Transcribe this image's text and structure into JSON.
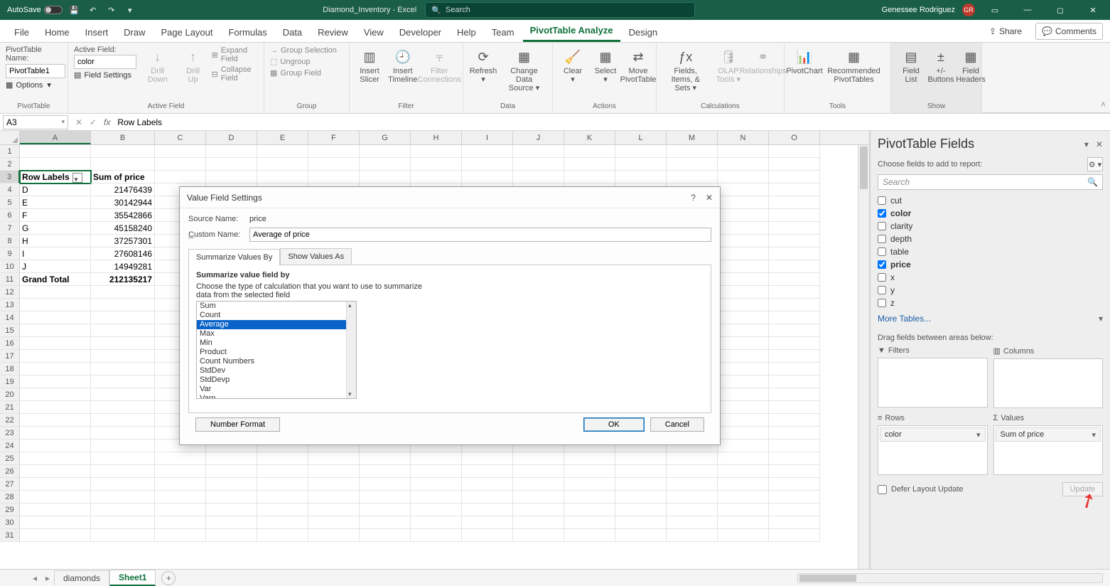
{
  "titlebar": {
    "autosave": "AutoSave",
    "autosave_state": "Off",
    "doc": "Diamond_Inventory  -  Excel",
    "search_placeholder": "Search",
    "user": "Genessee Rodriguez",
    "user_initials": "GR"
  },
  "tabs": [
    "File",
    "Home",
    "Insert",
    "Draw",
    "Page Layout",
    "Formulas",
    "Data",
    "Review",
    "View",
    "Developer",
    "Help",
    "Team",
    "PivotTable Analyze",
    "Design"
  ],
  "active_tab": "PivotTable Analyze",
  "ribbon_right": {
    "share": "Share",
    "comments": "Comments"
  },
  "ribbon": {
    "pt": {
      "name_label": "PivotTable Name:",
      "name_value": "PivotTable1",
      "options": "Options",
      "group_label": "PivotTable"
    },
    "af": {
      "name_label": "Active Field:",
      "name_value": "color",
      "settings": "Field Settings",
      "drill_down": "Drill\nDown",
      "drill_up": "Drill\nUp",
      "expand": "Expand Field",
      "collapse": "Collapse Field",
      "group_label": "Active Field"
    },
    "grp": {
      "sel": "Group Selection",
      "ungroup": "Ungroup",
      "field": "Group Field",
      "group_label": "Group"
    },
    "filter": {
      "slicer": "Insert\nSlicer",
      "timeline": "Insert\nTimeline",
      "conn": "Filter\nConnections",
      "group_label": "Filter"
    },
    "data": {
      "refresh": "Refresh",
      "change": "Change Data\nSource",
      "group_label": "Data"
    },
    "actions": {
      "clear": "Clear",
      "select": "Select",
      "move": "Move\nPivotTable",
      "group_label": "Actions"
    },
    "calc": {
      "fis": "Fields, Items,\n& Sets",
      "olap": "OLAP\nTools",
      "rel": "Relationships",
      "group_label": "Calculations"
    },
    "tools": {
      "chart": "PivotChart",
      "rec": "Recommended\nPivotTables",
      "group_label": "Tools"
    },
    "show": {
      "list": "Field\nList",
      "btns": "+/-\nButtons",
      "hdrs": "Field\nHeaders",
      "group_label": "Show"
    }
  },
  "namebox": "A3",
  "formula": "Row Labels",
  "columns": [
    "A",
    "B",
    "C",
    "D",
    "E",
    "F",
    "G",
    "H",
    "I",
    "J",
    "K",
    "L",
    "M",
    "N",
    "O"
  ],
  "pivot": {
    "header_row": "Row Labels",
    "header_val": "Sum of price",
    "rows": [
      {
        "label": "D",
        "val": "21476439"
      },
      {
        "label": "E",
        "val": "30142944"
      },
      {
        "label": "F",
        "val": "35542866"
      },
      {
        "label": "G",
        "val": "45158240"
      },
      {
        "label": "H",
        "val": "37257301"
      },
      {
        "label": "I",
        "val": "27608146"
      },
      {
        "label": "J",
        "val": "14949281"
      }
    ],
    "total_label": "Grand Total",
    "total_val": "212135217"
  },
  "dialog": {
    "title": "Value Field Settings",
    "source_label": "Source Name:",
    "source_value": "price",
    "custom_label": "Custom Name:",
    "custom_value": "Average of price",
    "tab1": "Summarize Values By",
    "tab2": "Show Values As",
    "section_hdr": "Summarize value field by",
    "desc1": "Choose the type of calculation that you want to use to summarize",
    "desc2": "data from the selected field",
    "options": [
      "Sum",
      "Count",
      "Average",
      "Max",
      "Min",
      "Product",
      "Count Numbers",
      "StdDev",
      "StdDevp",
      "Var",
      "Varp"
    ],
    "selected": "Average",
    "nfmt": "Number Format",
    "ok": "OK",
    "cancel": "Cancel"
  },
  "pane": {
    "title": "PivotTable Fields",
    "sub": "Choose fields to add to report:",
    "search": "Search",
    "fields": [
      {
        "name": "cut",
        "checked": false,
        "bold": false
      },
      {
        "name": "color",
        "checked": true,
        "bold": true
      },
      {
        "name": "clarity",
        "checked": false,
        "bold": false
      },
      {
        "name": "depth",
        "checked": false,
        "bold": false
      },
      {
        "name": "table",
        "checked": false,
        "bold": false
      },
      {
        "name": "price",
        "checked": true,
        "bold": true
      },
      {
        "name": "x",
        "checked": false,
        "bold": false
      },
      {
        "name": "y",
        "checked": false,
        "bold": false
      },
      {
        "name": "z",
        "checked": false,
        "bold": false
      }
    ],
    "more": "More Tables...",
    "drag": "Drag fields between areas below:",
    "filters": "Filters",
    "columns": "Columns",
    "rowsArea": "Rows",
    "valuesArea": "Values",
    "row_chip": "color",
    "val_chip": "Sum of price",
    "defer": "Defer Layout Update",
    "update": "Update"
  },
  "sheets": {
    "s1": "diamonds",
    "s2": "Sheet1"
  }
}
